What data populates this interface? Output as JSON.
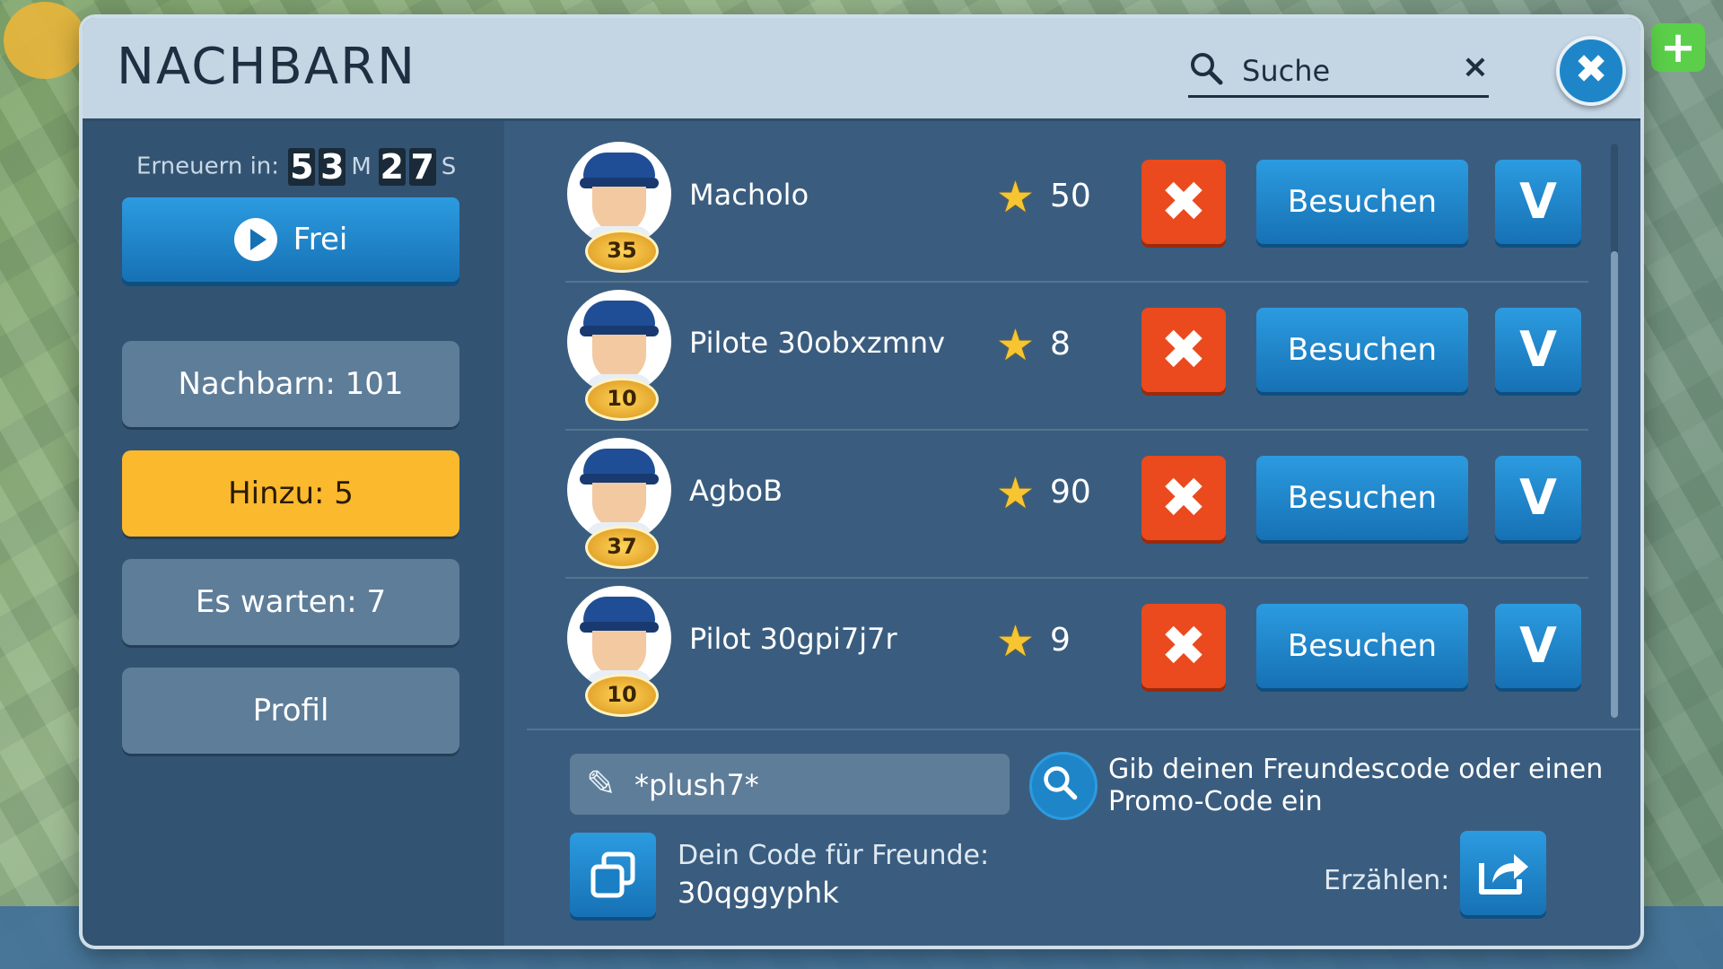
{
  "modal": {
    "title": "NACHBARN",
    "search": {
      "placeholder": "Suche",
      "clear_label": "×"
    },
    "close_label": "✖"
  },
  "sidebar": {
    "renew_label": "Erneuern in:",
    "timer": {
      "minutes": [
        "5",
        "3"
      ],
      "minutes_unit": "M",
      "seconds": [
        "2",
        "7"
      ],
      "seconds_unit": "S"
    },
    "free_button": "Frei",
    "menu": [
      {
        "label": "Nachbarn: 101",
        "active": false
      },
      {
        "label": "Hinzu: 5",
        "active": true
      },
      {
        "label": "Es warten: 7",
        "active": false
      },
      {
        "label": "Profil",
        "active": false
      }
    ]
  },
  "requests": [
    {
      "name": "Macholo",
      "level": "35",
      "stars": "50"
    },
    {
      "name": "Pilote 30obxzmnv",
      "level": "10",
      "stars": "8"
    },
    {
      "name": "AgboB",
      "level": "37",
      "stars": "90"
    },
    {
      "name": "Pilot 30gpi7j7r",
      "level": "10",
      "stars": "9"
    }
  ],
  "row_actions": {
    "remove": "✖",
    "visit": "Besuchen",
    "accept": "V"
  },
  "code_entry": {
    "value": "*plush7*",
    "hint": "Gib deinen Freundescode oder einen Promo-Code ein"
  },
  "friend_code": {
    "label": "Dein Code für Freunde:",
    "value": "30qggyphk"
  },
  "share": {
    "label": "Erzählen:"
  },
  "colors": {
    "panel": "#3a5d7f",
    "header": "#c4d6e4",
    "accent_blue": "#1e86c8",
    "remove_red": "#ea4a1d",
    "active_tab": "#fbb92e"
  }
}
